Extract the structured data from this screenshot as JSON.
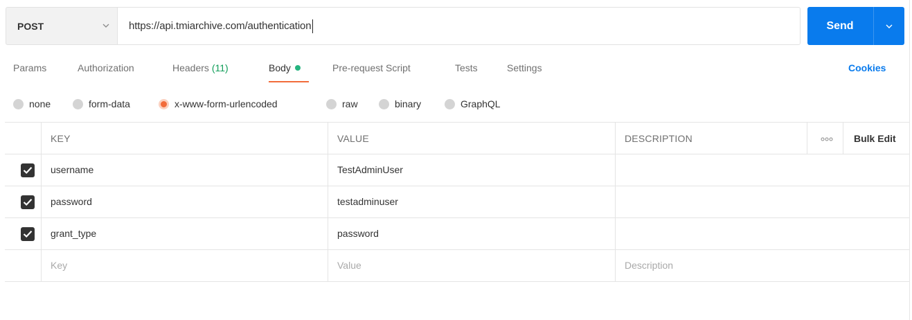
{
  "request": {
    "method": "POST",
    "url": "https://api.tmiarchive.com/authentication",
    "send_label": "Send"
  },
  "tabs": [
    {
      "label": "Params"
    },
    {
      "label": "Authorization"
    },
    {
      "label": "Headers",
      "count": "(11)"
    },
    {
      "label": "Body",
      "active": true
    },
    {
      "label": "Pre-request Script"
    },
    {
      "label": "Tests"
    },
    {
      "label": "Settings"
    }
  ],
  "cookies_label": "Cookies",
  "body_types": [
    {
      "label": "none",
      "checked": false
    },
    {
      "label": "form-data",
      "checked": false
    },
    {
      "label": "x-www-form-urlencoded",
      "checked": true
    },
    {
      "label": "raw",
      "checked": false
    },
    {
      "label": "binary",
      "checked": false
    },
    {
      "label": "GraphQL",
      "checked": false
    }
  ],
  "table": {
    "headers": {
      "key": "KEY",
      "value": "VALUE",
      "description": "DESCRIPTION",
      "bulk_edit": "Bulk Edit"
    },
    "rows": [
      {
        "checked": true,
        "key": "username",
        "value": "TestAdminUser",
        "description": ""
      },
      {
        "checked": true,
        "key": "password",
        "value": "testadminuser",
        "description": ""
      },
      {
        "checked": true,
        "key": "grant_type",
        "value": "password",
        "description": ""
      }
    ],
    "placeholders": {
      "key": "Key",
      "value": "Value",
      "description": "Description"
    }
  },
  "colors": {
    "accent": "#097bed",
    "active_tab": "#f26b3a",
    "status_dot": "#26b47f"
  }
}
